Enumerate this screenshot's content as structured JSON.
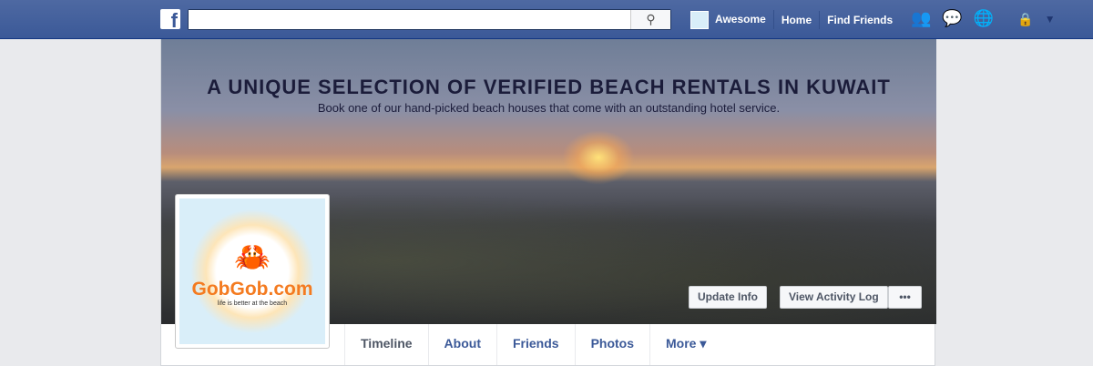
{
  "topbar": {
    "logo": "f",
    "search_placeholder": "",
    "user_name": "Awesome",
    "home": "Home",
    "find_friends": "Find Friends"
  },
  "cover": {
    "headline": "A UNIQUE SELECTION OF VERIFIED BEACH RENTALS IN KUWAIT",
    "subline": "Book one of our hand-picked beach houses that come with an outstanding hotel service.",
    "update_info": "Update Info",
    "view_activity_log": "View Activity Log",
    "more_dots": "•••"
  },
  "profile": {
    "logo_text": "GobGob.com",
    "tagline": "life is better at the beach"
  },
  "tabs": [
    {
      "label": "Timeline"
    },
    {
      "label": "About"
    },
    {
      "label": "Friends"
    },
    {
      "label": "Photos"
    },
    {
      "label": "More ▾"
    }
  ]
}
